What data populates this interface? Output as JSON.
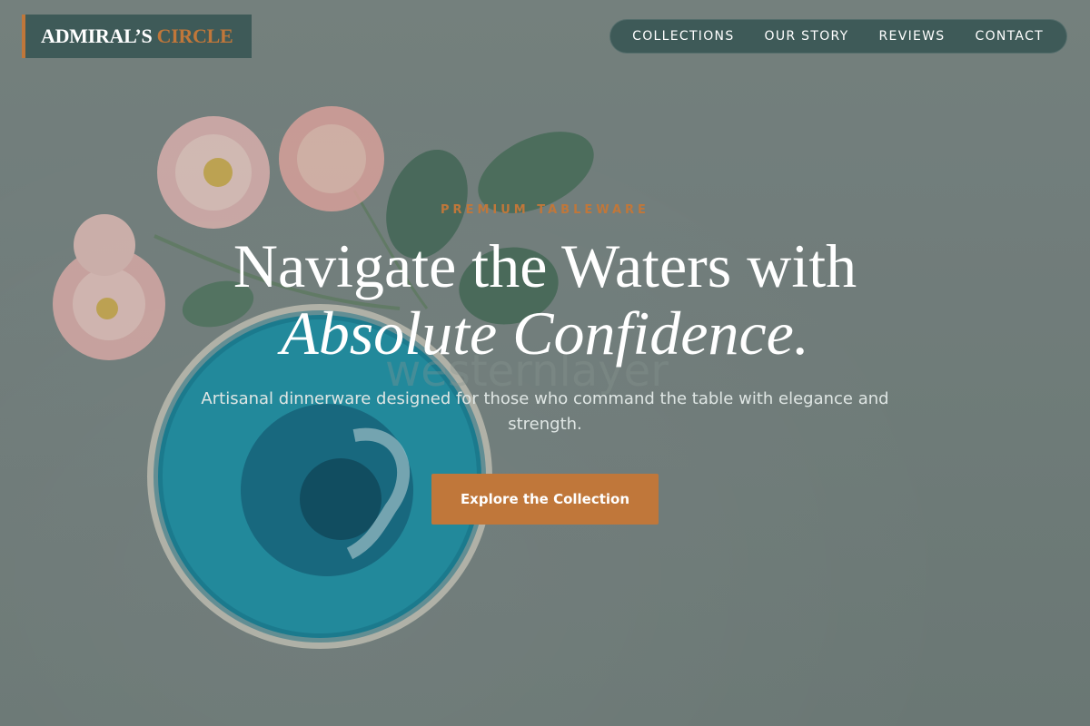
{
  "brand": {
    "name_part1": "ADMIRAL’S",
    "name_part2": "CIRCLE"
  },
  "nav": {
    "items": [
      {
        "label": "COLLECTIONS"
      },
      {
        "label": "OUR STORY"
      },
      {
        "label": "REVIEWS"
      },
      {
        "label": "CONTACT"
      }
    ]
  },
  "hero": {
    "eyebrow": "PREMIUM TABLEWARE",
    "headline_line1": "Navigate the Waters with",
    "headline_line2": "Absolute Confidence.",
    "subtext": "Artisanal dinnerware designed for those who command the table with elegance and strength.",
    "cta_label": "Explore the Collection",
    "background_image": "flowers-and-teal-ceramic-bowl-photo"
  },
  "colors": {
    "accent": "#c0773a",
    "brand_dark": "#3e5a58",
    "text_light": "#ffffff"
  }
}
